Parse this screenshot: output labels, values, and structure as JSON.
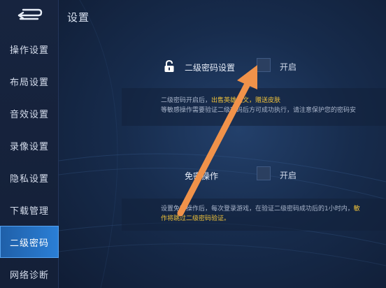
{
  "header": {
    "title": "设置"
  },
  "sidebar": {
    "items": [
      {
        "label": "操作设置"
      },
      {
        "label": "布局设置"
      },
      {
        "label": "音效设置"
      },
      {
        "label": "录像设置"
      },
      {
        "label": "隐私设置"
      },
      {
        "label": "下载管理"
      },
      {
        "label": "二级密码",
        "active": true
      },
      {
        "label": "网络诊断"
      }
    ]
  },
  "settings": {
    "secondary_password": {
      "label": "二级密码设置",
      "toggle_label": "开启",
      "checked": false,
      "desc_line1_prefix": "二级密码开启后，",
      "desc_line1_highlight": "出售英雄铭文，赠送皮肤",
      "desc_line2": "等敏感操作需要验证二级密码后方可成功执行，请注意保护您的密码安"
    },
    "password_free": {
      "label": "免密操作",
      "toggle_label": "开启",
      "checked": false,
      "desc_line1_prefix": "设置免密操作后，每次登录游戏，在验证二级密码成功后的1小时内，",
      "desc_line1_highlight": "敏",
      "desc_line2_highlight": "作将跳过二级密码验证。"
    }
  },
  "colors": {
    "accent": "#2b7fd6",
    "highlight": "#f1c33a",
    "annotation_arrow": "#f0924a"
  }
}
